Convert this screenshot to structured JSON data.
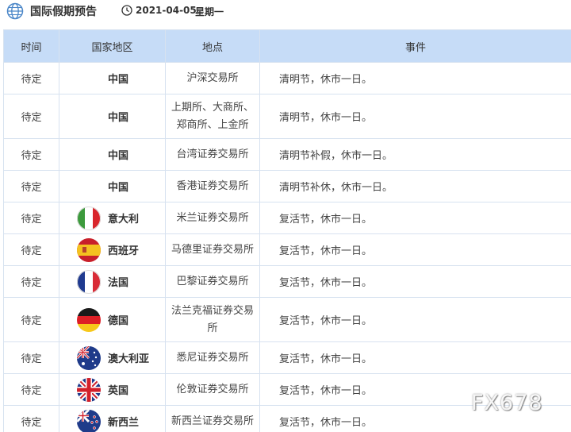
{
  "header": {
    "title": "国际假期预告",
    "date": "2021-04-05",
    "weekday": "星期一"
  },
  "table": {
    "columns": [
      "时间",
      "国家地区",
      "地点",
      "事件"
    ],
    "rows": [
      {
        "time": "待定",
        "flag": "",
        "country": "中国",
        "place": "沪深交易所",
        "event": "清明节，休市一日。"
      },
      {
        "time": "待定",
        "flag": "",
        "country": "中国",
        "place": "上期所、大商所、郑商所、上金所",
        "event": "清明节，休市一日。"
      },
      {
        "time": "待定",
        "flag": "",
        "country": "中国",
        "place": "台湾证券交易所",
        "event": "清明节补假，休市一日。"
      },
      {
        "time": "待定",
        "flag": "",
        "country": "中国",
        "place": "香港证券交易所",
        "event": "清明节补休，休市一日。"
      },
      {
        "time": "待定",
        "flag": "italy-flag-icon",
        "country": "意大利",
        "place": "米兰证券交易所",
        "event": "复活节，休市一日。"
      },
      {
        "time": "待定",
        "flag": "spain-flag-icon",
        "country": "西班牙",
        "place": "马德里证券交易所",
        "event": "复活节，休市一日。"
      },
      {
        "time": "待定",
        "flag": "france-flag-icon",
        "country": "法国",
        "place": "巴黎证券交易所",
        "event": "复活节，休市一日。"
      },
      {
        "time": "待定",
        "flag": "germany-flag-icon",
        "country": "德国",
        "place": "法兰克福证券交易所",
        "event": "复活节，休市一日。"
      },
      {
        "time": "待定",
        "flag": "australia-flag-icon",
        "country": "澳大利亚",
        "place": "悉尼证券交易所",
        "event": "复活节，休市一日。"
      },
      {
        "time": "待定",
        "flag": "uk-flag-icon",
        "country": "英国",
        "place": "伦敦证券交易所",
        "event": "复活节，休市一日。"
      },
      {
        "time": "待定",
        "flag": "new-zealand-flag-icon",
        "country": "新西兰",
        "place": "新西兰证券交易所",
        "event": "复活节，休市一日。"
      }
    ]
  },
  "watermark": "FX678"
}
